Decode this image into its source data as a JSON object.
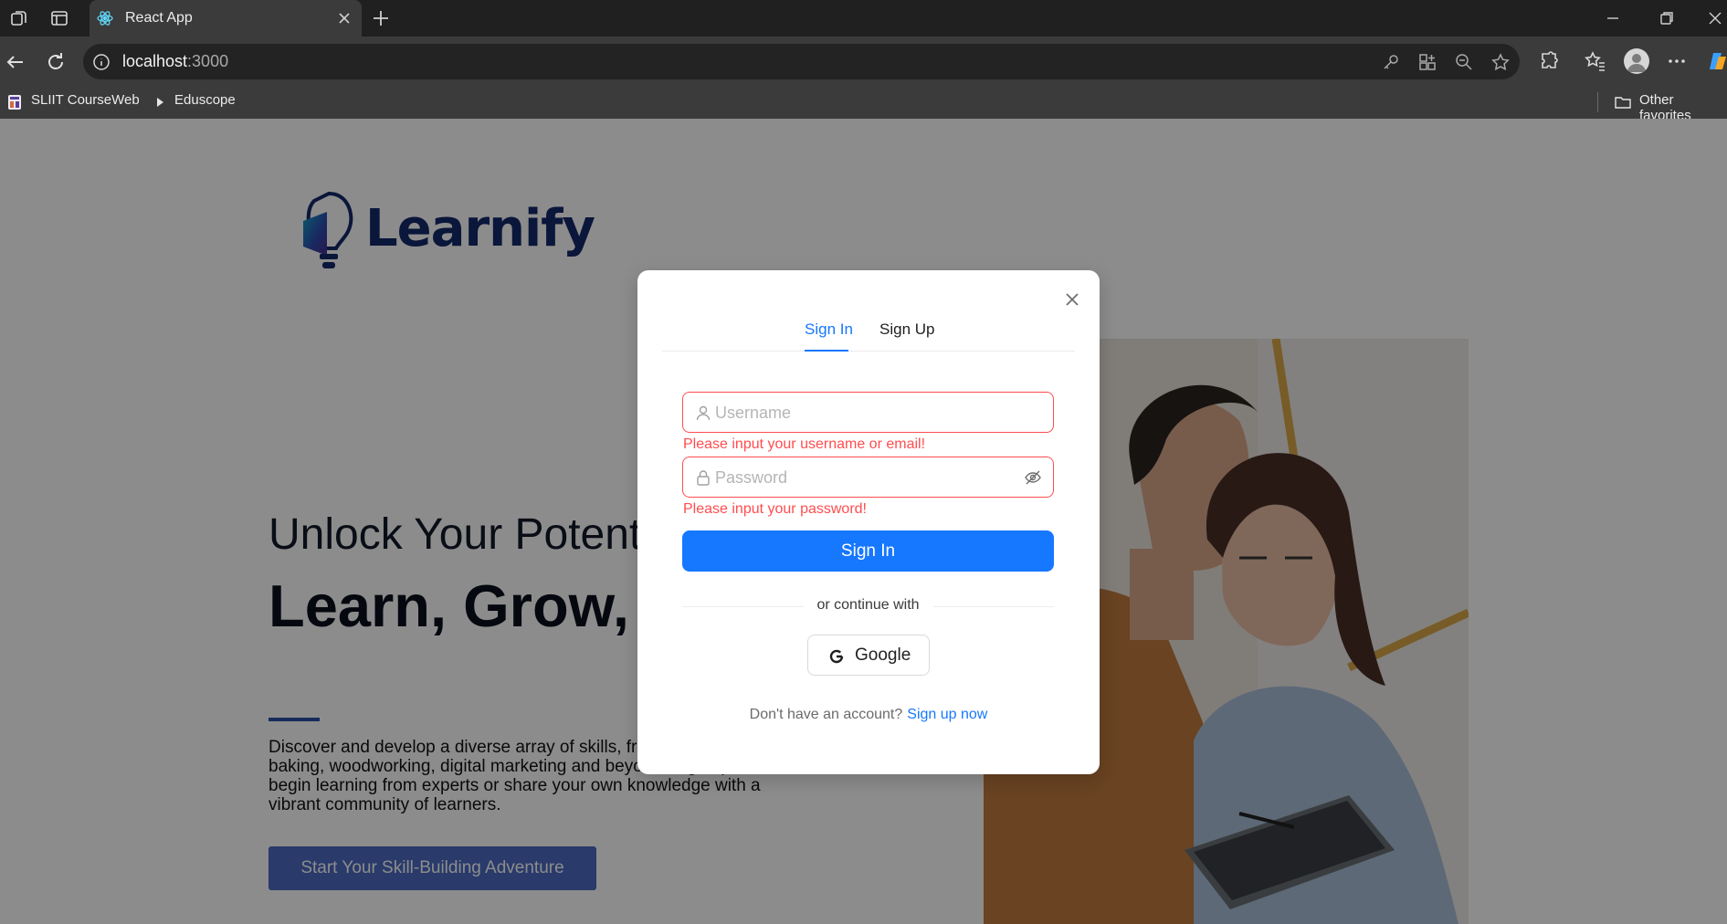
{
  "browser": {
    "tab_title": "React App",
    "url_host": "localhost",
    "url_port": ":3000",
    "favorites": [
      "SLIIT CourseWeb",
      "Eduscope"
    ],
    "other_favorites": "Other favorites"
  },
  "page": {
    "logo_text": "Learnify",
    "hero_subtitle": "Unlock Your Potential",
    "hero_title": "Learn, Grow, Succeed!",
    "hero_description": "Discover and develop a diverse array of skills, from graphic design to baking, woodworking, digital marketing and beyond. Sign up now to begin learning from experts or share your own knowledge with a vibrant community of learners.",
    "cta_label": "Start Your Skill-Building Adventure"
  },
  "modal": {
    "tabs": [
      "Sign In",
      "Sign Up"
    ],
    "active_tab": "Sign In",
    "username_placeholder": "Username",
    "username_value": "",
    "username_error": "Please input your username or email!",
    "password_placeholder": "Password",
    "password_value": "",
    "password_error": "Please input your password!",
    "submit_label": "Sign In",
    "divider_text": "or continue with",
    "google_label": "Google",
    "footer_text": "Don't have an account?",
    "footer_link": "Sign up now"
  },
  "colors": {
    "primary": "#1677ff",
    "error": "#ff4d4f",
    "brand_navy": "#13286b"
  },
  "icons": [
    "back-icon",
    "reload-icon",
    "info-icon",
    "key-icon",
    "apps-icon",
    "zoom-out-icon",
    "star-icon",
    "extensions-icon",
    "favorites-icon",
    "more-icon",
    "user-icon",
    "lock-icon",
    "eye-slash-icon",
    "google-icon",
    "close-icon"
  ]
}
